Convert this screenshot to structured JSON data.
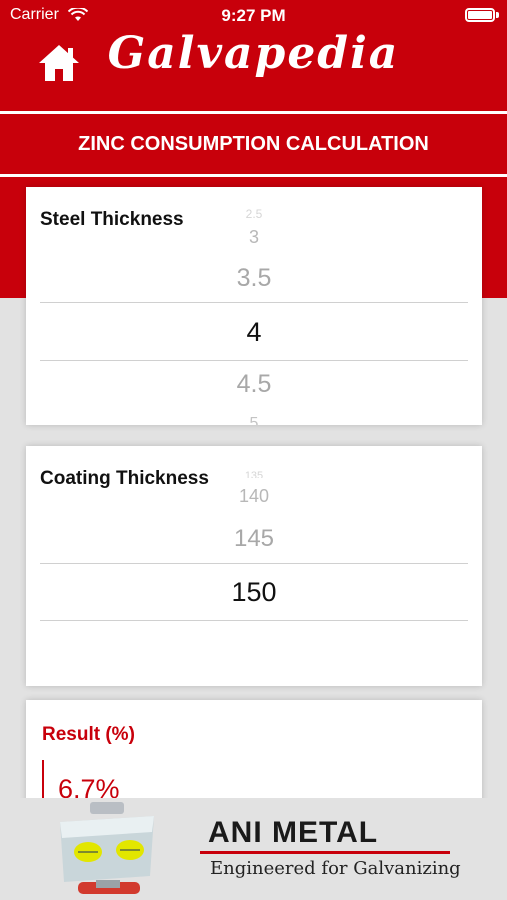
{
  "status_bar": {
    "carrier": "Carrier",
    "time": "9:27 PM"
  },
  "nav": {
    "title": "Galvapedia",
    "home_icon": "home-icon"
  },
  "section": {
    "title": "ZINC CONSUMPTION CALCULATION"
  },
  "steel_thickness": {
    "label": "Steel Thickness",
    "options": [
      "2.5",
      "3",
      "3.5",
      "4",
      "4.5",
      "5"
    ],
    "selected": "4"
  },
  "coating_thickness": {
    "label": "Coating Thickness",
    "options": [
      "135",
      "140",
      "145",
      "150"
    ],
    "selected": "150"
  },
  "result": {
    "label": "Result (%)",
    "value": "6.7%"
  },
  "footer": {
    "brand": "ANI METAL",
    "tagline": "Engineered for Galvanizing"
  },
  "colors": {
    "brand_red": "#c8000b",
    "background": "#e2e2e2"
  }
}
